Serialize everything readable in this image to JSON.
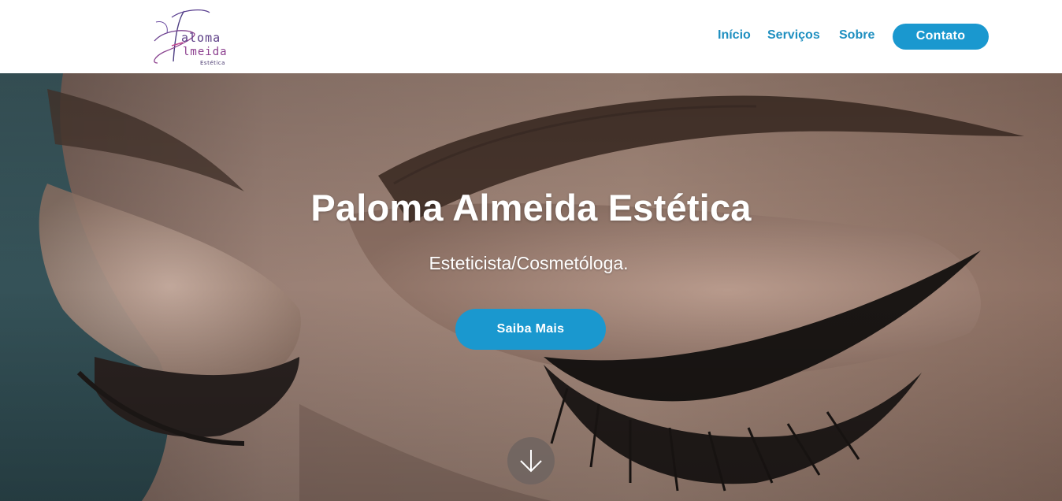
{
  "header": {
    "logo": {
      "line1": "aloma",
      "line2": "lmeida",
      "line3": "Estética"
    },
    "nav": [
      {
        "label": "Início"
      },
      {
        "label": "Serviços"
      },
      {
        "label": "Sobre"
      }
    ],
    "contact_label": "Contato"
  },
  "hero": {
    "title": "Paloma Almeida Estética",
    "subtitle": "Esteticista/Cosmetóloga.",
    "cta_label": "Saiba Mais",
    "scroll_icon": "arrow-down-icon"
  },
  "colors": {
    "accent": "#1a98cf",
    "nav_text": "#1e8fc0"
  }
}
